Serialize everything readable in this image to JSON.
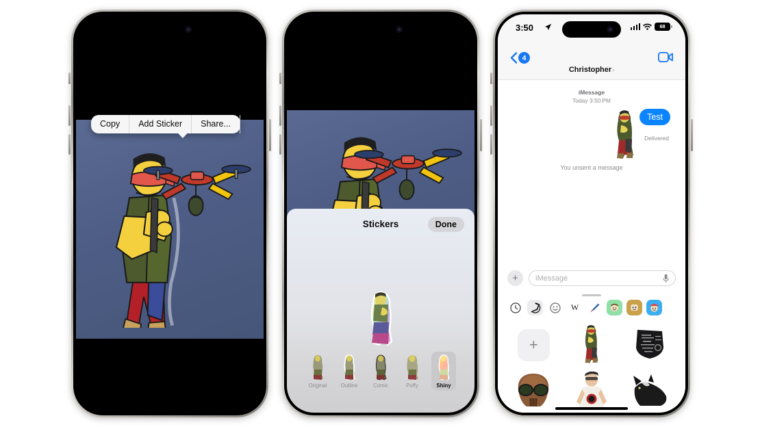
{
  "phone1": {
    "name": "iphone-photo-context-menu",
    "context_menu": {
      "copy": "Copy",
      "add_sticker": "Add Sticker",
      "share": "Share..."
    }
  },
  "phone2": {
    "name": "iphone-sticker-editor",
    "sheet": {
      "title": "Stickers",
      "done": "Done"
    },
    "effects": [
      {
        "label": "Original",
        "selected": false
      },
      {
        "label": "Outline",
        "selected": false
      },
      {
        "label": "Comic",
        "selected": false
      },
      {
        "label": "Puffy",
        "selected": false
      },
      {
        "label": "Shiny",
        "selected": true
      }
    ]
  },
  "phone3": {
    "name": "iphone-messages-thread",
    "status_bar": {
      "time": "3:50",
      "battery": "68",
      "location_icon": "location-arrow-icon",
      "signal_icon": "cellular-bars-icon",
      "wifi_icon": "wifi-icon"
    },
    "navbar": {
      "back_badge": "4",
      "back_icon": "chevron-left-icon",
      "title": "Christopher",
      "title_chevron": "›",
      "facetime_icon": "video-camera-icon"
    },
    "thread": {
      "service": "iMessage",
      "timestamp": "Today 3:50 PM",
      "bubble_text": "Test",
      "delivered": "Delivered",
      "unsent": "You unsent a message"
    },
    "input": {
      "plus_label": "+",
      "placeholder": "iMessage",
      "mic_icon": "microphone-icon"
    },
    "apps": [
      {
        "name": "recents-clock-icon",
        "selected": false
      },
      {
        "name": "stickers-icon",
        "selected": true
      },
      {
        "name": "emoji-smiley-icon",
        "selected": false
      },
      {
        "name": "wikipedia-icon",
        "selected": false
      },
      {
        "name": "brush-icon",
        "selected": false
      },
      {
        "name": "memoji-green-icon",
        "selected": false
      },
      {
        "name": "memoji-gold-icon",
        "selected": false
      },
      {
        "name": "memoji-blue-icon",
        "selected": false
      }
    ],
    "sticker_grid": [
      {
        "name": "add-sticker-tile",
        "label": "+"
      },
      {
        "name": "sticker-drone-pilot",
        "label": ""
      },
      {
        "name": "sticker-chalk-sign",
        "label": ""
      },
      {
        "name": "sticker-skull",
        "label": ""
      },
      {
        "name": "sticker-person",
        "label": ""
      },
      {
        "name": "sticker-black-cat",
        "label": ""
      }
    ]
  },
  "colors": {
    "imessage_blue": "#0b84ff",
    "badge_blue": "#1877f2",
    "photo_bg": "#4d5d85",
    "sheet_bg": "#e4e7ee"
  }
}
